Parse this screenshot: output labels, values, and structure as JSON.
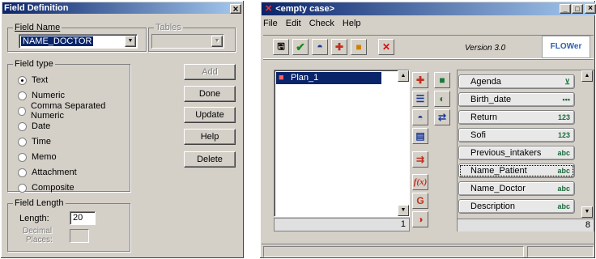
{
  "dialog": {
    "title": "Field Definition",
    "close_glyph": "×",
    "field_name_label": "Field Name",
    "field_name_value": "NAME_DOCTOR",
    "tables_label": "Tables",
    "field_type_label": "Field type",
    "field_types": [
      "Text",
      "Numeric",
      "Comma Separated Numeric",
      "Date",
      "Time",
      "Memo",
      "Attachment",
      "Composite"
    ],
    "selected_type": "Text",
    "buttons": {
      "add": "Add",
      "done": "Done",
      "update": "Update",
      "help": "Help",
      "delete": "Delete"
    },
    "field_length_label": "Field Length",
    "length_label": "Length:",
    "length_value": "20",
    "decimal_label_1": "Decimal",
    "decimal_label_2": "Places:"
  },
  "app": {
    "title": "<empty case>",
    "menu": [
      "File",
      "Edit",
      "Check",
      "Help"
    ],
    "version": "Version 3.0",
    "logo": "FLOWer",
    "plan_item": "Plan_1",
    "left_count": "1",
    "right_count": "8",
    "fields": [
      {
        "name": "Agenda",
        "tag": ""
      },
      {
        "name": "Birth_date",
        "tag": "•••"
      },
      {
        "name": "Return",
        "tag": "123"
      },
      {
        "name": "Sofi",
        "tag": "123"
      },
      {
        "name": "Previous_intakers",
        "tag": "abc"
      },
      {
        "name": "Name_Patient",
        "tag": "abc"
      },
      {
        "name": "Name_Doctor",
        "tag": "abc"
      },
      {
        "name": "Description",
        "tag": "abc"
      }
    ],
    "colors": {
      "titlebar_left": "#0a246a",
      "titlebar_right": "#a6caf0",
      "field_tag": "#1a6a3a"
    }
  }
}
